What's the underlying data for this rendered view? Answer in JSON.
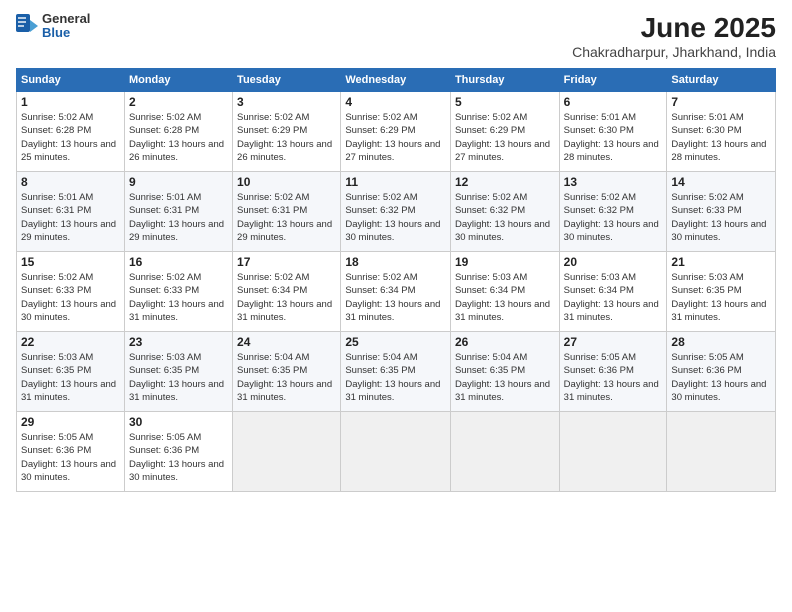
{
  "header": {
    "logo_general": "General",
    "logo_blue": "Blue",
    "title": "June 2025",
    "subtitle": "Chakradharpur, Jharkhand, India"
  },
  "calendar": {
    "days_of_week": [
      "Sunday",
      "Monday",
      "Tuesday",
      "Wednesday",
      "Thursday",
      "Friday",
      "Saturday"
    ],
    "weeks": [
      [
        {
          "day": "",
          "empty": true
        },
        {
          "day": "",
          "empty": true
        },
        {
          "day": "",
          "empty": true
        },
        {
          "day": "",
          "empty": true
        },
        {
          "day": "",
          "empty": true
        },
        {
          "day": "",
          "empty": true
        },
        {
          "day": "",
          "empty": true
        }
      ],
      [
        {
          "day": "1",
          "sunrise": "5:02 AM",
          "sunset": "6:28 PM",
          "daylight": "13 hours and 25 minutes."
        },
        {
          "day": "2",
          "sunrise": "5:02 AM",
          "sunset": "6:28 PM",
          "daylight": "13 hours and 26 minutes."
        },
        {
          "day": "3",
          "sunrise": "5:02 AM",
          "sunset": "6:29 PM",
          "daylight": "13 hours and 26 minutes."
        },
        {
          "day": "4",
          "sunrise": "5:02 AM",
          "sunset": "6:29 PM",
          "daylight": "13 hours and 27 minutes."
        },
        {
          "day": "5",
          "sunrise": "5:02 AM",
          "sunset": "6:29 PM",
          "daylight": "13 hours and 27 minutes."
        },
        {
          "day": "6",
          "sunrise": "5:01 AM",
          "sunset": "6:30 PM",
          "daylight": "13 hours and 28 minutes."
        },
        {
          "day": "7",
          "sunrise": "5:01 AM",
          "sunset": "6:30 PM",
          "daylight": "13 hours and 28 minutes."
        }
      ],
      [
        {
          "day": "8",
          "sunrise": "5:01 AM",
          "sunset": "6:31 PM",
          "daylight": "13 hours and 29 minutes."
        },
        {
          "day": "9",
          "sunrise": "5:01 AM",
          "sunset": "6:31 PM",
          "daylight": "13 hours and 29 minutes."
        },
        {
          "day": "10",
          "sunrise": "5:02 AM",
          "sunset": "6:31 PM",
          "daylight": "13 hours and 29 minutes."
        },
        {
          "day": "11",
          "sunrise": "5:02 AM",
          "sunset": "6:32 PM",
          "daylight": "13 hours and 30 minutes."
        },
        {
          "day": "12",
          "sunrise": "5:02 AM",
          "sunset": "6:32 PM",
          "daylight": "13 hours and 30 minutes."
        },
        {
          "day": "13",
          "sunrise": "5:02 AM",
          "sunset": "6:32 PM",
          "daylight": "13 hours and 30 minutes."
        },
        {
          "day": "14",
          "sunrise": "5:02 AM",
          "sunset": "6:33 PM",
          "daylight": "13 hours and 30 minutes."
        }
      ],
      [
        {
          "day": "15",
          "sunrise": "5:02 AM",
          "sunset": "6:33 PM",
          "daylight": "13 hours and 30 minutes."
        },
        {
          "day": "16",
          "sunrise": "5:02 AM",
          "sunset": "6:33 PM",
          "daylight": "13 hours and 31 minutes."
        },
        {
          "day": "17",
          "sunrise": "5:02 AM",
          "sunset": "6:34 PM",
          "daylight": "13 hours and 31 minutes."
        },
        {
          "day": "18",
          "sunrise": "5:02 AM",
          "sunset": "6:34 PM",
          "daylight": "13 hours and 31 minutes."
        },
        {
          "day": "19",
          "sunrise": "5:03 AM",
          "sunset": "6:34 PM",
          "daylight": "13 hours and 31 minutes."
        },
        {
          "day": "20",
          "sunrise": "5:03 AM",
          "sunset": "6:34 PM",
          "daylight": "13 hours and 31 minutes."
        },
        {
          "day": "21",
          "sunrise": "5:03 AM",
          "sunset": "6:35 PM",
          "daylight": "13 hours and 31 minutes."
        }
      ],
      [
        {
          "day": "22",
          "sunrise": "5:03 AM",
          "sunset": "6:35 PM",
          "daylight": "13 hours and 31 minutes."
        },
        {
          "day": "23",
          "sunrise": "5:03 AM",
          "sunset": "6:35 PM",
          "daylight": "13 hours and 31 minutes."
        },
        {
          "day": "24",
          "sunrise": "5:04 AM",
          "sunset": "6:35 PM",
          "daylight": "13 hours and 31 minutes."
        },
        {
          "day": "25",
          "sunrise": "5:04 AM",
          "sunset": "6:35 PM",
          "daylight": "13 hours and 31 minutes."
        },
        {
          "day": "26",
          "sunrise": "5:04 AM",
          "sunset": "6:35 PM",
          "daylight": "13 hours and 31 minutes."
        },
        {
          "day": "27",
          "sunrise": "5:05 AM",
          "sunset": "6:36 PM",
          "daylight": "13 hours and 31 minutes."
        },
        {
          "day": "28",
          "sunrise": "5:05 AM",
          "sunset": "6:36 PM",
          "daylight": "13 hours and 30 minutes."
        }
      ],
      [
        {
          "day": "29",
          "sunrise": "5:05 AM",
          "sunset": "6:36 PM",
          "daylight": "13 hours and 30 minutes."
        },
        {
          "day": "30",
          "sunrise": "5:05 AM",
          "sunset": "6:36 PM",
          "daylight": "13 hours and 30 minutes."
        },
        {
          "day": "",
          "empty": true
        },
        {
          "day": "",
          "empty": true
        },
        {
          "day": "",
          "empty": true
        },
        {
          "day": "",
          "empty": true
        },
        {
          "day": "",
          "empty": true
        }
      ]
    ]
  }
}
